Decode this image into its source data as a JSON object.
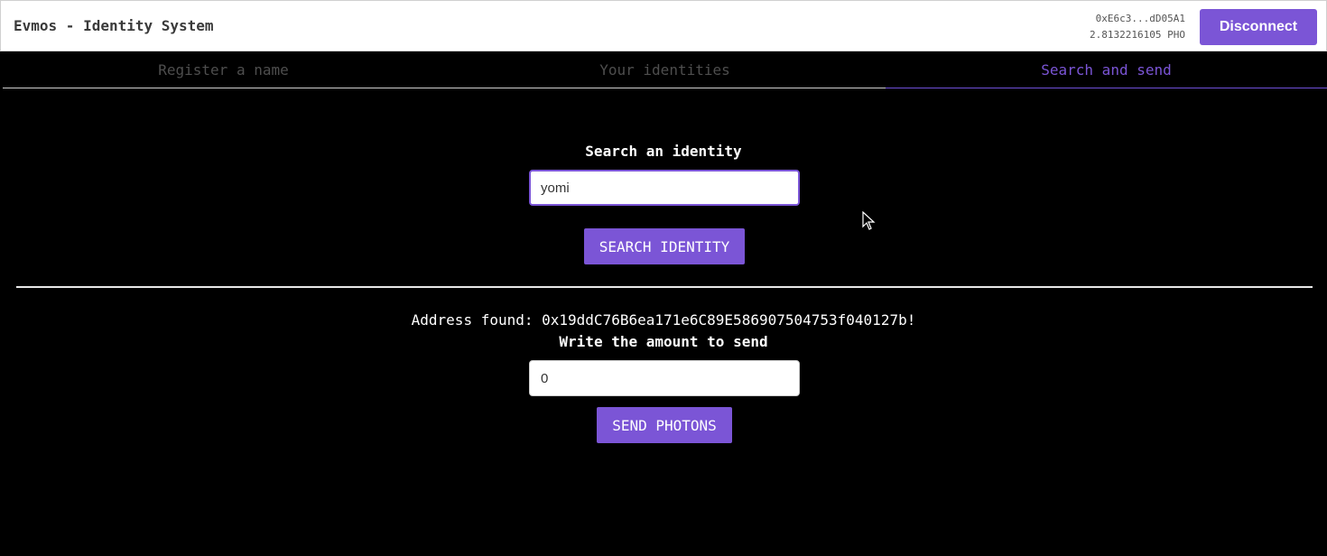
{
  "header": {
    "title": "Evmos - Identity System",
    "account_address": "0xE6c3...dD05A1",
    "balance": "2.8132216105 PHO",
    "disconnect_label": "Disconnect"
  },
  "tabs": [
    {
      "label": "Register a name",
      "active": false
    },
    {
      "label": "Your identities",
      "active": false
    },
    {
      "label": "Search and send",
      "active": true
    }
  ],
  "search": {
    "label": "Search an identity",
    "value": "yomi",
    "button_label": "SEARCH IDENTITY"
  },
  "result": {
    "address_found": "Address found: 0x19ddC76B6ea171e6C89E586907504753f040127b!",
    "amount_label": "Write the amount to send",
    "amount_value": "0",
    "send_label": "SEND PHOTONS"
  },
  "colors": {
    "accent": "#7b55d6",
    "background": "#000000",
    "header_bg": "#ffffff"
  }
}
